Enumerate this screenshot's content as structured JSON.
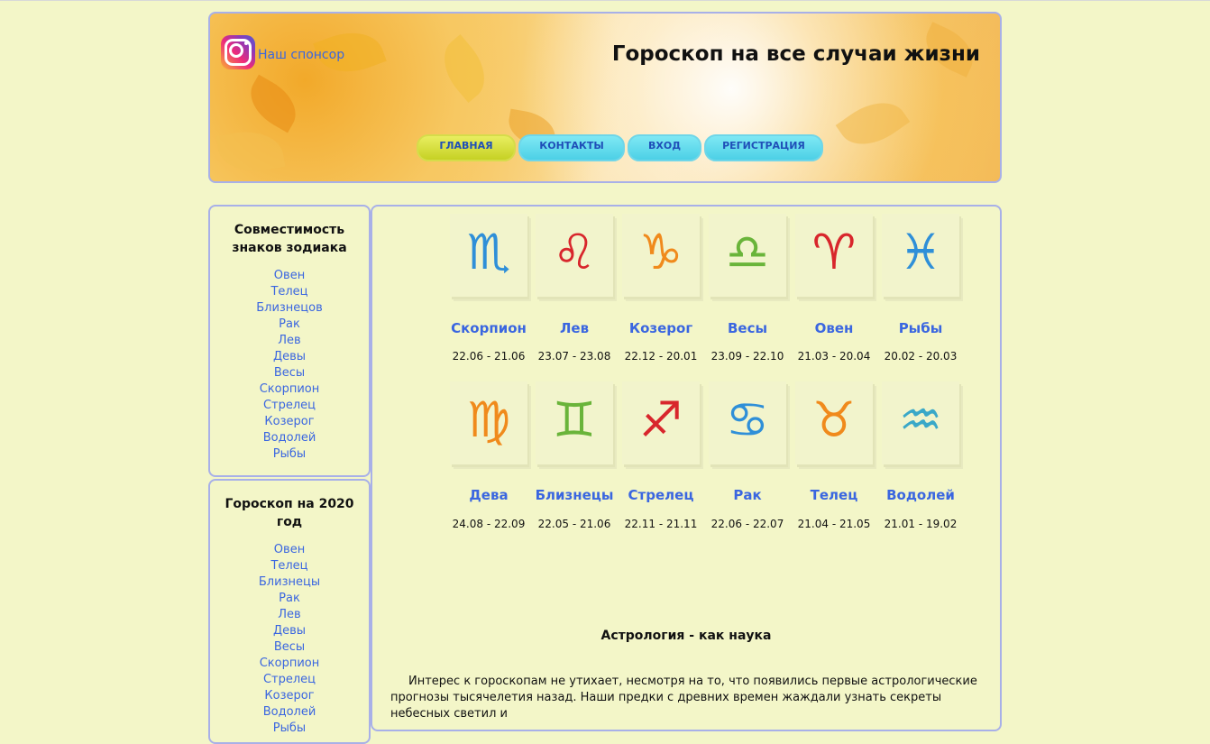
{
  "header": {
    "sponsor_label": "Наш спонсор",
    "site_title": "Гороскоп на все случаи жизни",
    "nav": [
      {
        "label": "ГЛАВНАЯ",
        "active": true
      },
      {
        "label": "КОНТАКТЫ",
        "active": false
      },
      {
        "label": "ВХОД",
        "active": false
      },
      {
        "label": "РЕГИСТРАЦИЯ",
        "active": false
      }
    ]
  },
  "sidebar": {
    "compat": {
      "title": "Совместимость знаков зодиака",
      "items": [
        "Овен",
        "Телец",
        "Близнецов",
        "Рак",
        "Лев",
        "Девы",
        "Весы",
        "Скорпион",
        "Стрелец",
        "Козерог",
        "Водолей",
        "Рыбы"
      ]
    },
    "horoscope2020": {
      "title": "Гороскоп на 2020 год",
      "items": [
        "Овен",
        "Телец",
        "Близнецы",
        "Рак",
        "Лев",
        "Девы",
        "Весы",
        "Скорпион",
        "Стрелец",
        "Козерог",
        "Водолей",
        "Рыбы"
      ]
    }
  },
  "signs": [
    {
      "name": "Скорпион",
      "dates": "22.06 - 21.06",
      "icon": "scorpio-icon",
      "color": "#2f8fd8"
    },
    {
      "name": "Лев",
      "dates": "23.07 - 23.08",
      "icon": "leo-icon",
      "color": "#d8262c"
    },
    {
      "name": "Козерог",
      "dates": "22.12 - 20.01",
      "icon": "capricorn-icon",
      "color": "#f08a1c"
    },
    {
      "name": "Весы",
      "dates": "23.09 - 22.10",
      "icon": "libra-icon",
      "color": "#6ab43a"
    },
    {
      "name": "Овен",
      "dates": "21.03 - 20.04",
      "icon": "aries-icon",
      "color": "#d8262c"
    },
    {
      "name": "Рыбы",
      "dates": "20.02 - 20.03",
      "icon": "pisces-icon",
      "color": "#2f8fd8"
    },
    {
      "name": "Дева",
      "dates": "24.08 - 22.09",
      "icon": "virgo-icon",
      "color": "#f08a1c"
    },
    {
      "name": "Близнецы",
      "dates": "22.05 - 21.06",
      "icon": "gemini-icon",
      "color": "#6ab43a"
    },
    {
      "name": "Стрелец",
      "dates": "22.11 - 21.11",
      "icon": "sagittarius-icon",
      "color": "#d8262c"
    },
    {
      "name": "Рак",
      "dates": "22.06 - 22.07",
      "icon": "cancer-icon",
      "color": "#2f8fd8"
    },
    {
      "name": "Телец",
      "dates": "21.04 - 21.05",
      "icon": "taurus-icon",
      "color": "#f08a1c"
    },
    {
      "name": "Водолей",
      "dates": "21.01 - 19.02",
      "icon": "aquarius-icon",
      "color": "#3aa8c8"
    }
  ],
  "article": {
    "title": "Астрология - как наука",
    "text": "Интерес к гороскопам не утихает, несмотря на то, что появились первые астрологические прогнозы тысячелетия назад. Наши предки с древних времен жаждали узнать секреты небесных светил и"
  }
}
